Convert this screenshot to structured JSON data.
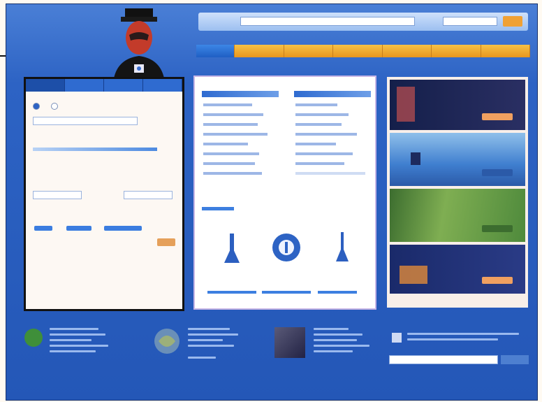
{
  "header": {
    "logo_text": "",
    "logo_sub": "",
    "search_placeholder": "",
    "search_scope": "",
    "search_button": ""
  },
  "nav": {
    "tabs": [
      "",
      "",
      "",
      "",
      "",
      "",
      ""
    ]
  },
  "left_panel": {
    "tabs": [
      "",
      "",
      "",
      ""
    ],
    "option_a": "",
    "option_b": "",
    "field_one": "",
    "label_one": "",
    "label_two": "",
    "value_one": "",
    "value_two": "",
    "value_three": ""
  },
  "mid_panel": {
    "col1_heading": "",
    "col2_heading": "",
    "section_heading": "",
    "captions": [
      "",
      "",
      ""
    ]
  },
  "promos": [
    {
      "title": "",
      "button": ""
    },
    {
      "title": "",
      "button": ""
    },
    {
      "title": "",
      "button": ""
    },
    {
      "title": "",
      "button": ""
    }
  ],
  "footer": {
    "newsletter_placeholder": "",
    "newsletter_button": ""
  },
  "colors": {
    "page_blue": "#2457b7",
    "nav_orange": "#e8961f",
    "active_tab_blue": "#1f5fc4",
    "promo_dark": "#1d2a5e",
    "promo_green": "#4f8a3c"
  },
  "icons": [
    "mascot-icon",
    "search-icon",
    "pin-icon",
    "globe-icon",
    "flag-icon",
    "phone-icon",
    "map-icon",
    "mail-icon"
  ]
}
